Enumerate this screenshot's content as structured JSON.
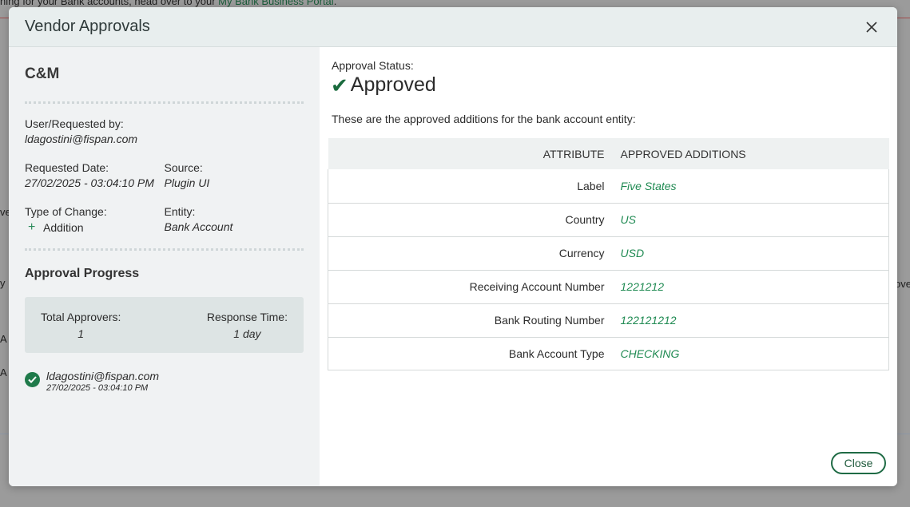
{
  "background": {
    "notice_prefix": "hing for your Bank accounts, head over to your ",
    "notice_link": "My Bank Business Portal",
    "notice_suffix": ".",
    "left_fragments": [
      "ve",
      "y",
      "A",
      "A"
    ],
    "right_fragment": "ove"
  },
  "modal": {
    "title": "Vendor Approvals",
    "close_icon": "close-icon"
  },
  "left": {
    "entity_name": "C&M",
    "requested_by_label": "User/Requested by:",
    "requested_by_value": "ldagostini@fispan.com",
    "requested_date_label": "Requested Date:",
    "requested_date_value": "27/02/2025 - 03:04:10 PM",
    "source_label": "Source:",
    "source_value": "Plugin UI",
    "type_label": "Type of Change:",
    "type_value": "Addition",
    "entity_label": "Entity:",
    "entity_value": "Bank Account",
    "progress_title": "Approval Progress",
    "total_approvers_label": "Total Approvers:",
    "total_approvers_value": "1",
    "response_time_label": "Response Time:",
    "response_time_value": "1 day",
    "approver_email": "ldagostini@fispan.com",
    "approver_date": "27/02/2025 - 03:04:10 PM"
  },
  "right": {
    "status_label": "Approval Status:",
    "status_value": "Approved",
    "description": "These are the approved additions for the bank account entity:",
    "col_attribute": "ATTRIBUTE",
    "col_additions": "APPROVED ADDITIONS",
    "rows": [
      {
        "attribute": "Label",
        "value": "Five States"
      },
      {
        "attribute": "Country",
        "value": "US"
      },
      {
        "attribute": "Currency",
        "value": "USD"
      },
      {
        "attribute": "Receiving Account Number",
        "value": "1221212"
      },
      {
        "attribute": "Bank Routing Number",
        "value": "122121212"
      },
      {
        "attribute": "Bank Account Type",
        "value": "CHECKING"
      }
    ],
    "close_label": "Close"
  },
  "colors": {
    "accent_green": "#1f7a4a",
    "value_green": "#1f8a52",
    "header_bg": "#e8eeee",
    "left_panel_bg": "#f0f2f3"
  }
}
